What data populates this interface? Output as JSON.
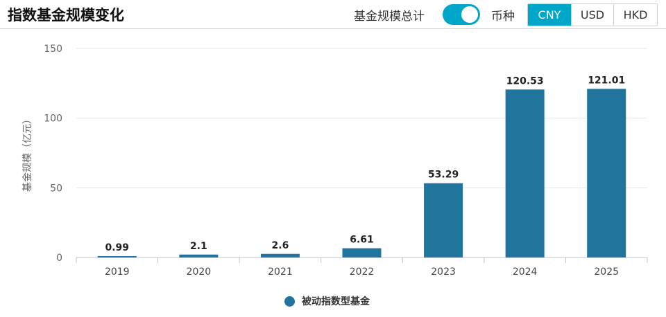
{
  "header": {
    "title": "指数基金规模变化",
    "toggle_label": "基金规模总计",
    "toggle_on": true,
    "currency_label": "币种",
    "currencies": [
      "CNY",
      "USD",
      "HKD"
    ],
    "active_currency": "CNY",
    "accent_color": "#00a6c8"
  },
  "chart_data": {
    "type": "bar",
    "title": "",
    "xlabel": "",
    "ylabel": "基金规模（亿元）",
    "categories": [
      "2019",
      "2020",
      "2021",
      "2022",
      "2023",
      "2024",
      "2025"
    ],
    "series": [
      {
        "name": "被动指数型基金",
        "values": [
          0.99,
          2.1,
          2.6,
          6.61,
          53.29,
          120.53,
          121.01
        ],
        "color": "#21749e"
      }
    ],
    "ylim": [
      0,
      150
    ],
    "yticks": [
      0,
      50,
      100,
      150
    ],
    "grid": true,
    "legend_position": "bottom",
    "data_labels": true
  }
}
